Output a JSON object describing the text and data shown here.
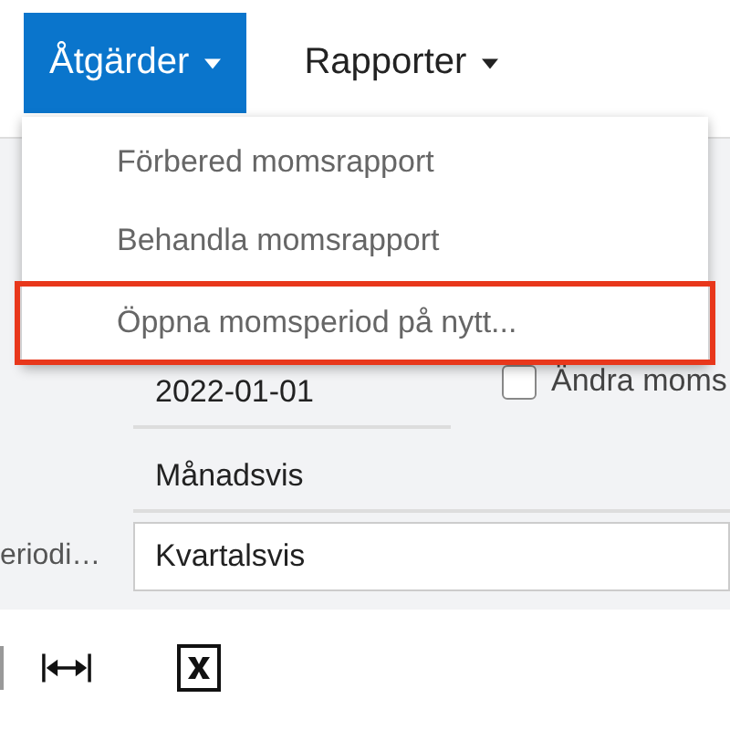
{
  "toolbar": {
    "menus": [
      {
        "label": "Åtgärder",
        "selected": true
      },
      {
        "label": "Rapporter",
        "selected": false
      }
    ]
  },
  "dropdown": {
    "items": [
      {
        "label": "Förbered momsrapport",
        "highlighted": false
      },
      {
        "label": "Behandla momsrapport",
        "highlighted": false
      },
      {
        "label": "Öppna momsperiod på nytt...",
        "highlighted": true
      }
    ]
  },
  "form": {
    "date": "2022-01-01",
    "checkbox": {
      "label": "Ändra moms",
      "checked": false
    },
    "period": "Månadsvis",
    "field_label": "eriodi…",
    "field_value": "Kvartalsvis"
  }
}
